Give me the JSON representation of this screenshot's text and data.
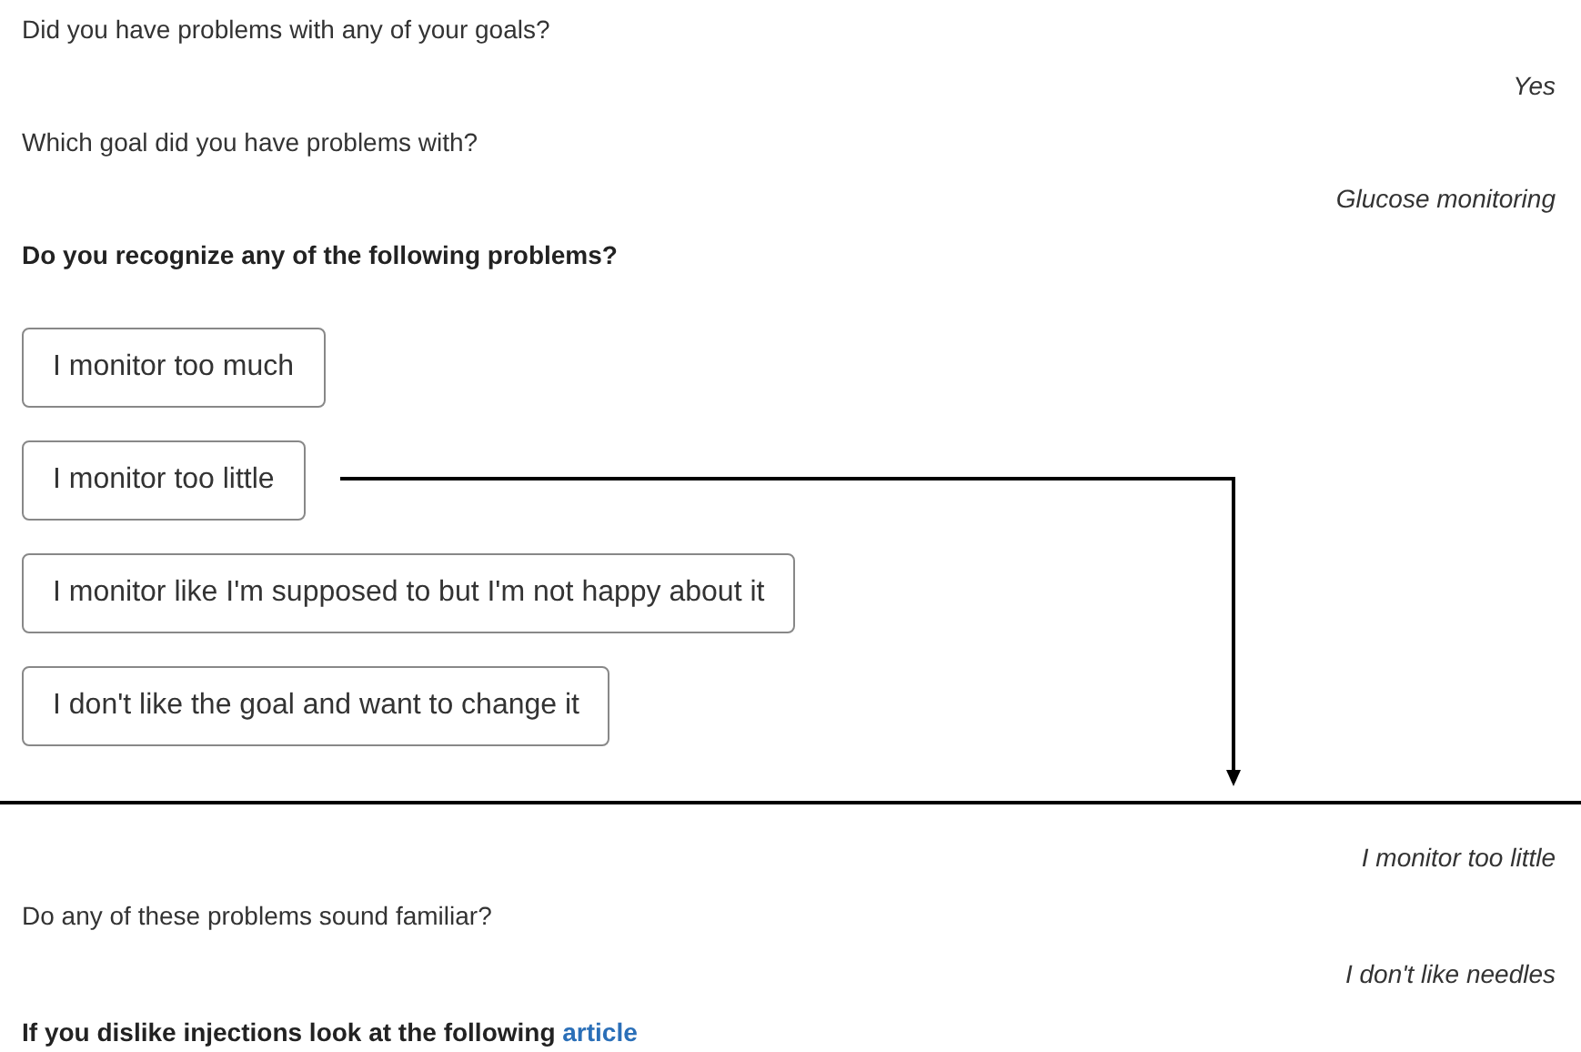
{
  "chat_before": [
    {
      "kind": "question",
      "text": "Did you have problems with any of your goals?"
    },
    {
      "kind": "answer",
      "text": "Yes"
    },
    {
      "kind": "question",
      "text": "Which goal did you have problems with?"
    },
    {
      "kind": "answer",
      "text": "Glucose monitoring"
    },
    {
      "kind": "prompt",
      "text": "Do you recognize any of the following problems?"
    }
  ],
  "options": [
    {
      "label": "I monitor too much"
    },
    {
      "label": "I monitor too little"
    },
    {
      "label": "I monitor like I'm supposed to but I'm not happy about it"
    },
    {
      "label": "I don't like the goal and want to change it"
    }
  ],
  "chat_after": [
    {
      "kind": "answer",
      "text": "I monitor too little"
    },
    {
      "kind": "question",
      "text": "Do any of these problems sound familiar?"
    },
    {
      "kind": "answer",
      "text": "I don't like needles"
    },
    {
      "kind": "prompt",
      "text": "If you dislike injections look at the following",
      "link": "article"
    }
  ]
}
